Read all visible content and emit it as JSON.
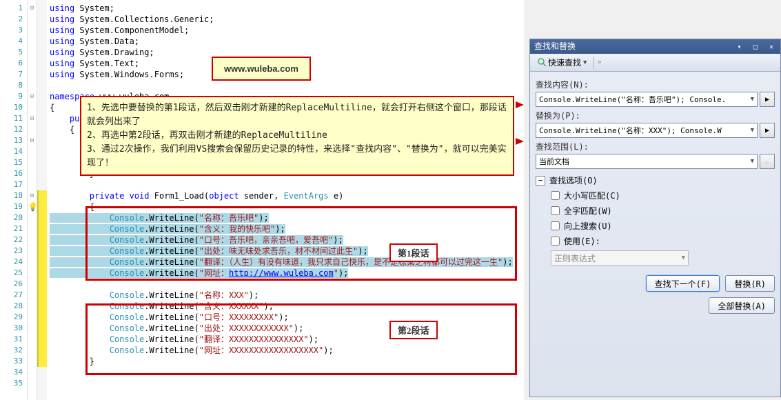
{
  "url_box": "www.wuleba.com",
  "note": {
    "l1": "1、先选中要替换的第1段话，然后双击刚才新建的ReplaceMultiline，就会打开右侧这个窗口，那段话就会列出来了",
    "l2": "2、再选中第2段话，再双击刚才新建的ReplaceMultiline",
    "l3": "3、通过2次操作，我们利用VS搜索会保留历史记录的特性，来选择\"查找内容\"、\"替换为\"，就可以完美实现了！"
  },
  "seg_labels": {
    "l1": "第1段话",
    "l2": "第2段话"
  },
  "code": {
    "lines": [
      {
        "n": 1,
        "fold": "-",
        "tokens": [
          [
            "kw",
            "using"
          ],
          [
            "pln",
            " System;"
          ]
        ]
      },
      {
        "n": 2,
        "tokens": [
          [
            "kw",
            "using"
          ],
          [
            "pln",
            " System.Collections.Generic;"
          ]
        ]
      },
      {
        "n": 3,
        "tokens": [
          [
            "kw",
            "using"
          ],
          [
            "pln",
            " System.ComponentModel;"
          ]
        ]
      },
      {
        "n": 4,
        "tokens": [
          [
            "kw",
            "using"
          ],
          [
            "pln",
            " System.Data;"
          ]
        ]
      },
      {
        "n": 5,
        "tokens": [
          [
            "kw",
            "using"
          ],
          [
            "pln",
            " System.Drawing;"
          ]
        ]
      },
      {
        "n": 6,
        "tokens": [
          [
            "kw",
            "using"
          ],
          [
            "pln",
            " System.Text;"
          ]
        ]
      },
      {
        "n": 7,
        "tokens": [
          [
            "kw",
            "using"
          ],
          [
            "pln",
            " System.Windows.Forms;"
          ]
        ]
      },
      {
        "n": 8,
        "tokens": []
      },
      {
        "n": 9,
        "fold": "-",
        "tokens": [
          [
            "kw",
            "namespace"
          ],
          [
            "pln",
            " www.wuleba.com"
          ]
        ]
      },
      {
        "n": 10,
        "tokens": [
          [
            "pln",
            "{"
          ]
        ]
      },
      {
        "n": 11,
        "fold": "-",
        "tokens": [
          [
            "pln",
            "    "
          ],
          [
            "kw",
            "public"
          ]
        ]
      },
      {
        "n": 12,
        "tokens": [
          [
            "pln",
            "    {"
          ]
        ]
      },
      {
        "n": 13,
        "fold": "-",
        "tokens": [
          [
            "pln",
            "        pu"
          ]
        ]
      },
      {
        "n": 14,
        "tokens": [
          [
            "pln",
            "        {"
          ]
        ]
      },
      {
        "n": 15,
        "tokens": []
      },
      {
        "n": 16,
        "tokens": [
          [
            "pln",
            "        }"
          ]
        ]
      },
      {
        "n": 17,
        "tokens": []
      },
      {
        "n": 18,
        "fold": "-",
        "mark": "ylw",
        "tokens": [
          [
            "pln",
            "        "
          ],
          [
            "kw",
            "private"
          ],
          [
            "pln",
            " "
          ],
          [
            "kw",
            "void"
          ],
          [
            "pln",
            " Form1_Load("
          ],
          [
            "kw",
            "object"
          ],
          [
            "pln",
            " sender, "
          ],
          [
            "cls",
            "EventArgs"
          ],
          [
            "pln",
            " e)"
          ]
        ]
      },
      {
        "n": 19,
        "mark": "ylw",
        "tokens": [
          [
            "pln",
            "        {"
          ]
        ]
      },
      {
        "n": 20,
        "mark": "ylw",
        "sel": true,
        "tokens": [
          [
            "pln",
            "            "
          ],
          [
            "cls",
            "Console"
          ],
          [
            "pln",
            ".WriteLine("
          ],
          [
            "str",
            "\"名称：吾乐吧\""
          ],
          [
            "pln",
            ");"
          ]
        ]
      },
      {
        "n": 21,
        "mark": "ylw",
        "sel": true,
        "tokens": [
          [
            "pln",
            "            "
          ],
          [
            "cls",
            "Console"
          ],
          [
            "pln",
            ".WriteLine("
          ],
          [
            "str",
            "\"含义：我的快乐吧\""
          ],
          [
            "pln",
            ");"
          ]
        ]
      },
      {
        "n": 22,
        "mark": "ylw",
        "sel": true,
        "tokens": [
          [
            "pln",
            "            "
          ],
          [
            "cls",
            "Console"
          ],
          [
            "pln",
            ".WriteLine("
          ],
          [
            "str",
            "\"口号：吾乐吧，亲亲吾吧，爱吾吧\""
          ],
          [
            "pln",
            ");"
          ]
        ]
      },
      {
        "n": 23,
        "mark": "ylw",
        "sel": true,
        "tokens": [
          [
            "pln",
            "            "
          ],
          [
            "cls",
            "Console"
          ],
          [
            "pln",
            ".WriteLine("
          ],
          [
            "str",
            "\"出处：味无味处求吾乐，材不材间过此生\""
          ],
          [
            "pln",
            ");"
          ]
        ]
      },
      {
        "n": 24,
        "mark": "ylw",
        "sel": true,
        "tokens": [
          [
            "pln",
            "            "
          ],
          [
            "cls",
            "Console"
          ],
          [
            "pln",
            ".WriteLine("
          ],
          [
            "str",
            "\"翻译：（人生）有没有味道，我只求自己快乐，是不是栋梁之材都可以过完这一生\""
          ],
          [
            "pln",
            ");"
          ]
        ]
      },
      {
        "n": 25,
        "mark": "ylw",
        "sel": true,
        "tokens": [
          [
            "pln",
            "            "
          ],
          [
            "cls",
            "Console"
          ],
          [
            "pln",
            ".WriteLine("
          ],
          [
            "str",
            "\"网址："
          ],
          [
            "lnk",
            "http://www.wuleba.com"
          ],
          [
            "str",
            "\""
          ],
          [
            "pln",
            ");"
          ]
        ]
      },
      {
        "n": 26,
        "mark": "ylw",
        "tokens": []
      },
      {
        "n": 27,
        "mark": "ylw",
        "tokens": [
          [
            "pln",
            "            "
          ],
          [
            "cls",
            "Console"
          ],
          [
            "pln",
            ".WriteLine("
          ],
          [
            "str",
            "\"名称：XXX\""
          ],
          [
            "pln",
            ");"
          ]
        ]
      },
      {
        "n": 28,
        "mark": "ylw",
        "tokens": [
          [
            "pln",
            "            "
          ],
          [
            "cls",
            "Console"
          ],
          [
            "pln",
            ".WriteLine("
          ],
          [
            "str",
            "\"含义：XXXXXX\""
          ],
          [
            "pln",
            ");"
          ]
        ]
      },
      {
        "n": 29,
        "mark": "ylw",
        "tokens": [
          [
            "pln",
            "            "
          ],
          [
            "cls",
            "Console"
          ],
          [
            "pln",
            ".WriteLine("
          ],
          [
            "str",
            "\"口号：XXXXXXXXX\""
          ],
          [
            "pln",
            ");"
          ]
        ]
      },
      {
        "n": 30,
        "mark": "ylw",
        "tokens": [
          [
            "pln",
            "            "
          ],
          [
            "cls",
            "Console"
          ],
          [
            "pln",
            ".WriteLine("
          ],
          [
            "str",
            "\"出处：XXXXXXXXXXXX\""
          ],
          [
            "pln",
            ");"
          ]
        ]
      },
      {
        "n": 31,
        "mark": "ylw",
        "tokens": [
          [
            "pln",
            "            "
          ],
          [
            "cls",
            "Console"
          ],
          [
            "pln",
            ".WriteLine("
          ],
          [
            "str",
            "\"翻译：XXXXXXXXXXXXXXX\""
          ],
          [
            "pln",
            ");"
          ]
        ]
      },
      {
        "n": 32,
        "mark": "ylw",
        "tokens": [
          [
            "pln",
            "            "
          ],
          [
            "cls",
            "Console"
          ],
          [
            "pln",
            ".WriteLine("
          ],
          [
            "str",
            "\"网址：XXXXXXXXXXXXXXXXXX\""
          ],
          [
            "pln",
            ");"
          ]
        ]
      },
      {
        "n": 33,
        "mark": "ylw",
        "tokens": [
          [
            "pln",
            "        }"
          ]
        ]
      },
      {
        "n": 34,
        "tokens": []
      },
      {
        "n": 35,
        "tokens": []
      }
    ]
  },
  "panel": {
    "title": "查找和替换",
    "toolbar_label": "快速查找",
    "find_label": "查找内容(N):",
    "find_value": "Console.WriteLine(\"名称：吾乐吧\");            Console.",
    "replace_label": "替换为(P):",
    "replace_value": "Console.WriteLine(\"名称：XXX\");            Console.W",
    "scope_label": "查找范围(L):",
    "scope_value": "当前文档",
    "options_label": "查找选项(O)",
    "opt_case": "大小写匹配(C)",
    "opt_whole": "全字匹配(W)",
    "opt_up": "向上搜索(U)",
    "opt_use": "使用(E):",
    "opt_regex": "正则表达式",
    "btn_findnext": "查找下一个(F)",
    "btn_replace": "替换(R)",
    "btn_replaceall": "全部替换(A)"
  }
}
